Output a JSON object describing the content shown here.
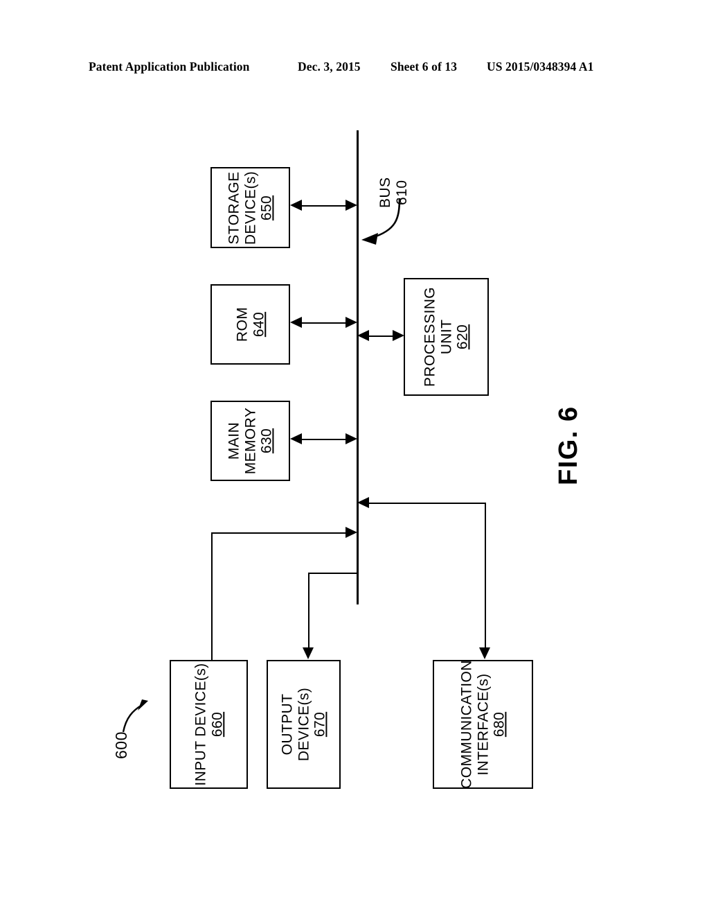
{
  "header": {
    "publication": "Patent Application Publication",
    "date": "Dec. 3, 2015",
    "sheet": "Sheet 6 of 13",
    "patent_number": "US 2015/0348394 A1"
  },
  "figure": {
    "caption": "FIG. 6",
    "system_ref": "600",
    "bus": {
      "label": "BUS",
      "ref": "610"
    },
    "blocks": [
      {
        "id": "storage",
        "lines": [
          "STORAGE",
          "DEVICE(s)"
        ],
        "ref": "650"
      },
      {
        "id": "rom",
        "lines": [
          "ROM"
        ],
        "ref": "640"
      },
      {
        "id": "memory",
        "lines": [
          "MAIN",
          "MEMORY"
        ],
        "ref": "630"
      },
      {
        "id": "cpu",
        "lines": [
          "PROCESSING",
          "UNIT"
        ],
        "ref": "620"
      },
      {
        "id": "input",
        "lines": [
          "INPUT DEVICE(s)"
        ],
        "ref": "660"
      },
      {
        "id": "output",
        "lines": [
          "OUTPUT",
          "DEVICE(s)"
        ],
        "ref": "670"
      },
      {
        "id": "comm",
        "lines": [
          "COMMUNICATION",
          "INTERFACE(s)"
        ],
        "ref": "680"
      }
    ]
  },
  "colors": {
    "ink": "#000000",
    "paper": "#ffffff"
  }
}
